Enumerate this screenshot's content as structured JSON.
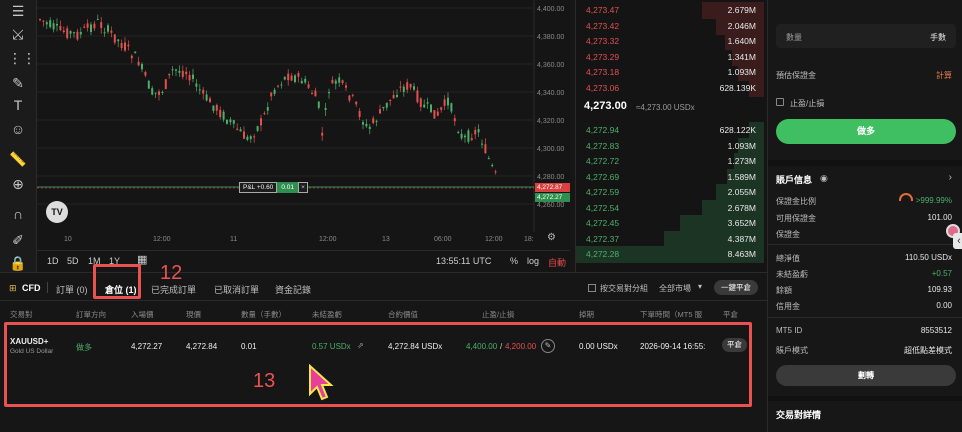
{
  "toolbar": {
    "icons": [
      "menu-lines-icon",
      "cross-lines-icon",
      "indicator-icon",
      "brush-icon",
      "text-tool-icon",
      "emoji-icon",
      "ruler-icon",
      "zoom-in-icon",
      "magnet-icon",
      "pencil-lock-icon",
      "lock-icon"
    ]
  },
  "chart": {
    "price_ticks": [
      "4,400.00",
      "4,380.00",
      "4,360.00",
      "4,340.00",
      "4,320.00",
      "4,300.00",
      "4,280.00",
      "4,260.00"
    ],
    "time_ticks": [
      "10",
      "12:00",
      "11",
      "12:00",
      "13",
      "06:00",
      "12:00",
      "18:"
    ],
    "pnl_label": "P&L +0.60",
    "pnl_qty": "0.01",
    "current_price_tag": "4,272.87",
    "position_price_tag": "4,272.27",
    "timeframes": [
      "1D",
      "5D",
      "1M",
      "1Y"
    ],
    "clock": "13:55:11 UTC",
    "scale_pct": "%",
    "scale_log": "log",
    "scale_auto": "自動"
  },
  "orderbook": {
    "asks": [
      {
        "price": "4,273.47",
        "size": "2.679M"
      },
      {
        "price": "4,273.42",
        "size": "2.046M"
      },
      {
        "price": "4,273.32",
        "size": "1.640M"
      },
      {
        "price": "4,273.29",
        "size": "1.341M"
      },
      {
        "price": "4,273.18",
        "size": "1.093M"
      },
      {
        "price": "4,273.06",
        "size": "628.139K"
      }
    ],
    "mid_price": "4,273.00",
    "mid_equiv": "≈4,273.00 USDx",
    "bids": [
      {
        "price": "4,272.94",
        "size": "628.122K"
      },
      {
        "price": "4,272.83",
        "size": "1.093M"
      },
      {
        "price": "4,272.72",
        "size": "1.273M"
      },
      {
        "price": "4,272.69",
        "size": "1.589M"
      },
      {
        "price": "4,272.59",
        "size": "2.055M"
      },
      {
        "price": "4,272.54",
        "size": "2.678M"
      },
      {
        "price": "4,272.45",
        "size": "3.652M"
      },
      {
        "price": "4,272.37",
        "size": "4.387M"
      },
      {
        "price": "4,272.28",
        "size": "8.463M"
      }
    ]
  },
  "right_panel": {
    "qty_label": "數量",
    "qty_unit": "手數",
    "margin_label": "預估保證金",
    "margin_value": "計算",
    "tpsl_label": "止盈/止損",
    "long_button": "做多",
    "account_title": "賬戶信息",
    "margin_ratio_label": "保證金比例",
    "margin_ratio_value": ">999.99%",
    "available_margin_label": "可用保證金",
    "available_margin_value": "101.00",
    "margin_label2": "保證金",
    "net_value_label": "總淨值",
    "net_value": "110.50 USDx",
    "unrealized_label": "未結盈虧",
    "unrealized_value": "+0.57",
    "balance_label": "餘額",
    "balance_value": "109.93",
    "credit_label": "信用金",
    "credit_value": "0.00",
    "mt5_label": "MT5 ID",
    "mt5_value": "8553512",
    "mode_label": "賬戶模式",
    "mode_value": "超低點差模式",
    "transfer_button": "劃轉",
    "pair_detail_title": "交易對詳情"
  },
  "bottom": {
    "cfd_tab": "CFD",
    "tabs": [
      "訂單 (0)",
      "倉位 (1)",
      "已完成訂單",
      "已取消訂單",
      "資金記錄"
    ],
    "group_by_pair": "按交易對分組",
    "market_filter": "全部市場",
    "close_all_button": "一鍵平倉",
    "headers": [
      "交易對",
      "訂單方向",
      "入場價",
      "現價",
      "數量（手數）",
      "未結盈虧",
      "合約價值",
      "止盈/止損",
      "掉期",
      "下單時間（MT5 服",
      "平倉"
    ],
    "row": {
      "symbol": "XAUUSD+",
      "symbol_desc": "Gold US Dollar",
      "side": "做多",
      "entry": "4,272.27",
      "current": "4,272.84",
      "qty": "0.01",
      "pnl": "0.57 USDx",
      "contract_value": "4,272.84 USDx",
      "tp": "4,400.00",
      "sl": "4,200.00",
      "swap": "0.00 USDx",
      "time": "2026-09-14 16:55:",
      "close_button": "平倉"
    }
  },
  "annotations": {
    "label_12": "12",
    "label_13": "13"
  },
  "colors": {
    "up": "#4caf6a",
    "down": "#e35050",
    "accent_green": "#3fbf62",
    "annotation": "#ea5252"
  }
}
